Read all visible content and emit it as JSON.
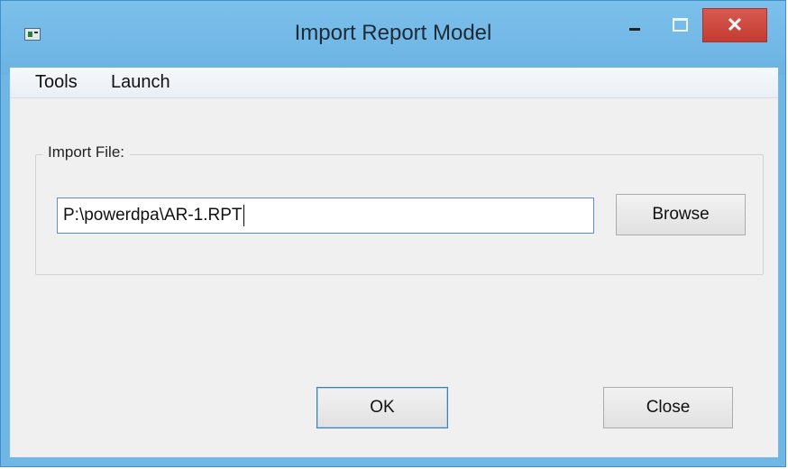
{
  "window": {
    "title": "Import Report Model",
    "controls": {
      "minimize": "–",
      "maximize": "□",
      "close": "✕"
    }
  },
  "menu": {
    "items": [
      {
        "label": "Tools"
      },
      {
        "label": "Launch"
      }
    ]
  },
  "import_group": {
    "label": "Import File:",
    "file_path_value": "P:\\powerdpa\\AR-1.RPT",
    "browse_label": "Browse"
  },
  "buttons": {
    "ok_label": "OK",
    "close_label": "Close"
  },
  "colors": {
    "titlebar": "#6cb3e2",
    "close_button": "#c9463c",
    "client_background": "#f0f0f0",
    "input_focus_border": "#5b8fd0"
  }
}
